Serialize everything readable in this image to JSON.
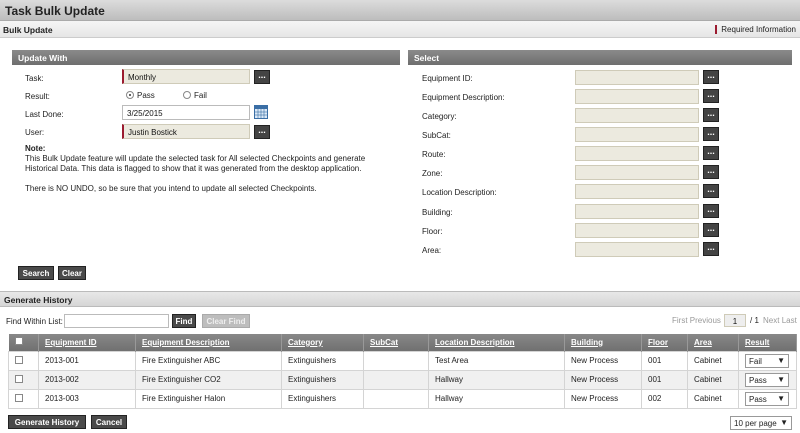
{
  "window": {
    "title": "Task Bulk Update"
  },
  "subheader": {
    "title": "Bulk Update",
    "required_info": "Required Information"
  },
  "update_with": {
    "header": "Update With",
    "task": {
      "label": "Task:",
      "value": "Monthly"
    },
    "result": {
      "label": "Result:",
      "options": [
        "Pass",
        "Fail"
      ],
      "selected": "Pass"
    },
    "last_done": {
      "label": "Last Done:",
      "value": "3/25/2015"
    },
    "user": {
      "label": "User:",
      "value": "Justin Bostick"
    },
    "note_title": "Note:",
    "note_text": "This Bulk Update feature will update the selected task for All selected Checkpoints and generate Historical Data. This data is flagged to show that it was generated from the desktop application.",
    "warning": "There is NO UNDO, so be sure that you intend to update all selected Checkpoints."
  },
  "select_panel": {
    "header": "Select",
    "fields": [
      "Equipment ID:",
      "Equipment Description:",
      "Category:",
      "SubCat:",
      "Route:",
      "Zone:",
      "Location Description:",
      "Building:",
      "Floor:",
      "Area:"
    ]
  },
  "buttons": {
    "search": "Search",
    "clear": "Clear",
    "find": "Find",
    "clear_find": "Clear Find",
    "generate_history": "Generate History",
    "cancel": "Cancel",
    "lookup": "..."
  },
  "generate_history": {
    "header": "Generate History",
    "find_label": "Find Within List:"
  },
  "pagination": {
    "first": "First",
    "previous": "Previous",
    "page": "1",
    "of": "/ 1",
    "next": "Next",
    "last": "Last",
    "per_page": "10 per page"
  },
  "table": {
    "columns": [
      "Equipment ID",
      "Equipment Description",
      "Category",
      "SubCat",
      "Location Description",
      "Building",
      "Floor",
      "Area",
      "Result"
    ],
    "rows": [
      {
        "id": "2013-001",
        "desc": "Fire Extinguisher ABC",
        "category": "Extinguishers",
        "subcat": "",
        "location": "Test Area",
        "building": "New Process",
        "floor": "001",
        "area": "Cabinet",
        "result": "Fail"
      },
      {
        "id": "2013-002",
        "desc": "Fire Extinguisher CO2",
        "category": "Extinguishers",
        "subcat": "",
        "location": "Hallway",
        "building": "New Process",
        "floor": "001",
        "area": "Cabinet",
        "result": "Pass"
      },
      {
        "id": "2013-003",
        "desc": "Fire Extinguisher Halon",
        "category": "Extinguishers",
        "subcat": "",
        "location": "Hallway",
        "building": "New Process",
        "floor": "002",
        "area": "Cabinet",
        "result": "Pass"
      }
    ]
  },
  "colors": {
    "required_marker": "#9b1b30",
    "header_bg": "#7a7a7a",
    "field_bg": "#eceadf"
  }
}
